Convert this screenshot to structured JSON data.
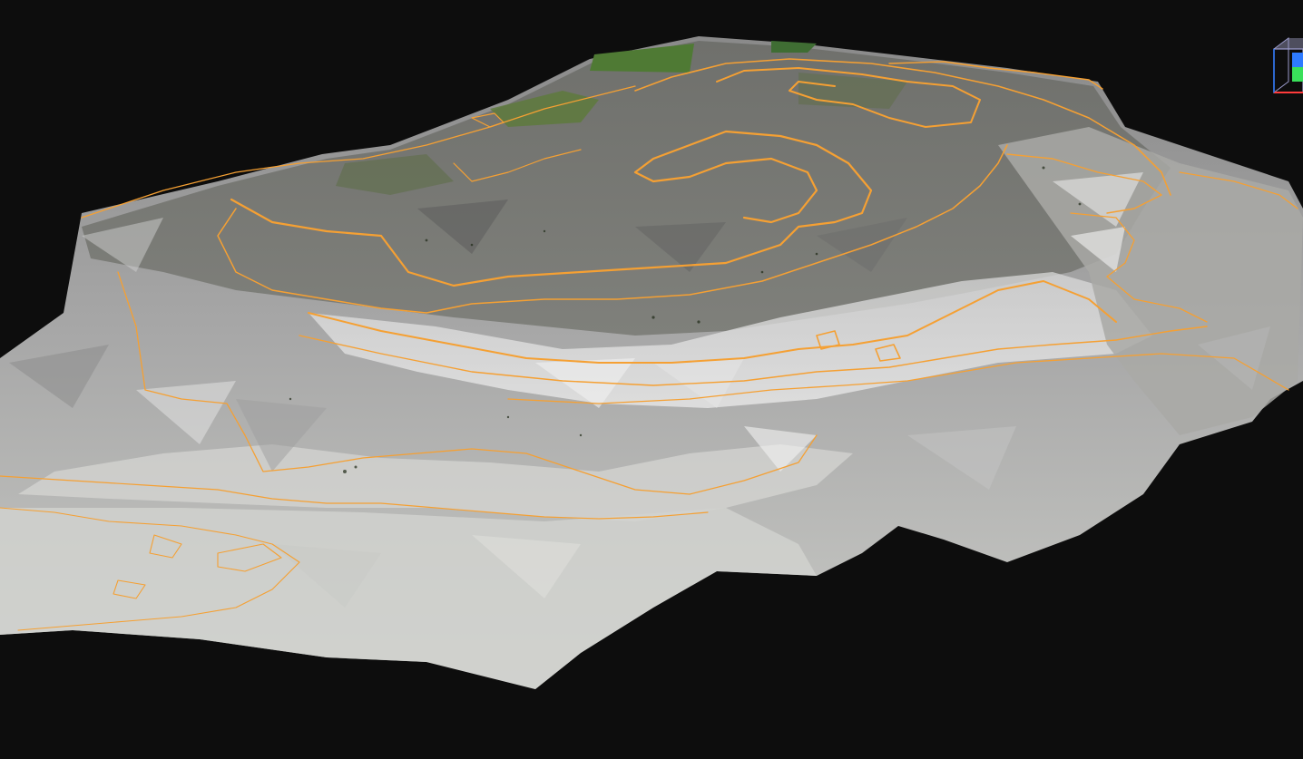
{
  "viewer": {
    "background_color": "#0d0d0d",
    "terrain_base_color": "#b9b9b9",
    "terrain_dark_color": "#6e6e6e",
    "vegetation_color": "#5e7d3a",
    "contour_color": "#f5a033"
  },
  "navigation_cube": {
    "icon": "axis-cube-icon",
    "x_axis_color": "#ff3b3b",
    "y_axis_color": "#39e05a",
    "z_axis_color": "#2e7bff"
  }
}
